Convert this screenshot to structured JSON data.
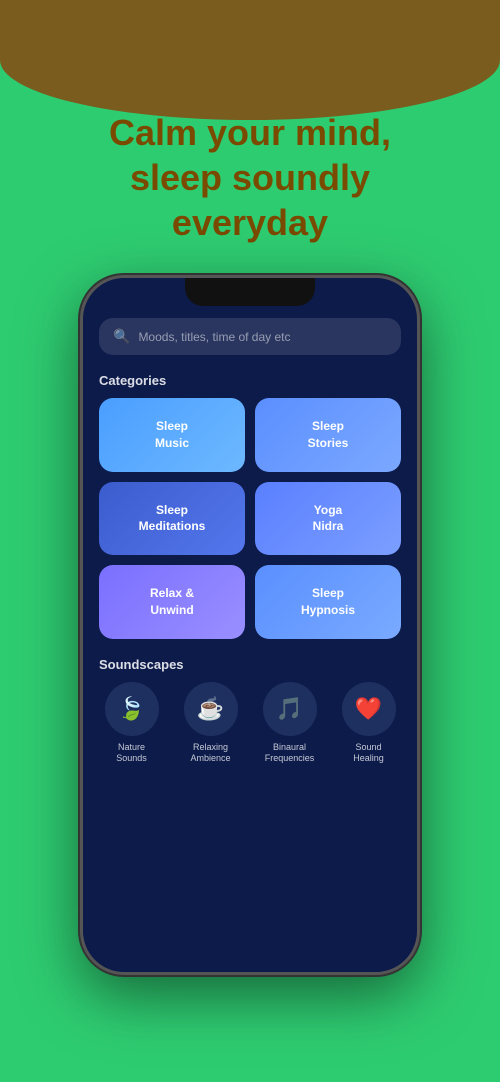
{
  "background": {
    "top_color": "#7a5c1e",
    "main_color": "#2ecc71"
  },
  "hero": {
    "title_line1": "Calm your mind,",
    "title_line2": "sleep soundly",
    "title_line3": "everyday"
  },
  "search": {
    "placeholder": "Moods, titles, time of day etc"
  },
  "categories_section": {
    "title": "Categories",
    "items": [
      {
        "label": "Sleep\nMusic",
        "style": "card-blue-light"
      },
      {
        "label": "Sleep\nStories",
        "style": "card-blue-medium"
      },
      {
        "label": "Sleep\nMeditations",
        "style": "card-blue-dark"
      },
      {
        "label": "Yoga\nNidra",
        "style": "card-blue-grad"
      },
      {
        "label": "Relax &\nUnwind",
        "style": "card-purple"
      },
      {
        "label": "Sleep\nHypnosis",
        "style": "card-blue-sleep"
      }
    ]
  },
  "soundscapes_section": {
    "title": "Soundscapes",
    "items": [
      {
        "icon": "🍃",
        "label": "Nature\nSounds"
      },
      {
        "icon": "☕",
        "label": "Relaxing\nAmbience"
      },
      {
        "icon": "🎵",
        "label": "Binaural\nFrequencies"
      },
      {
        "icon": "❤️",
        "label": "Sound\nHealing"
      }
    ]
  }
}
